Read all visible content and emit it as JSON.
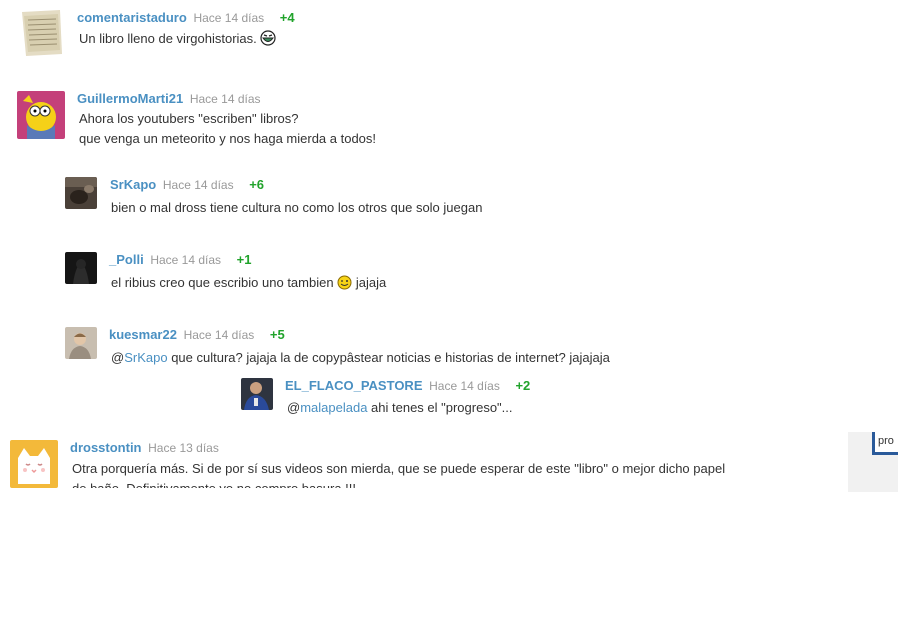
{
  "comments": [
    {
      "user": "comentaristaduro",
      "time": "Hace 14 días",
      "votes": "+4",
      "lines": [
        "Un libro lleno de virgohistorias."
      ]
    },
    {
      "user": "GuillermoMarti21",
      "time": "Hace 14 días",
      "votes": "",
      "lines": [
        "Ahora los youtubers \"escriben\" libros?",
        "que venga un meteorito y nos haga mierda a todos!"
      ]
    },
    {
      "user": "SrKapo",
      "time": "Hace 14 días",
      "votes": "+6",
      "lines": [
        "bien o mal dross tiene cultura no como los otros que solo juegan"
      ]
    },
    {
      "user": "_Polli",
      "time": "Hace 14 días",
      "votes": "+1",
      "text_before": "el ribius creo que escribio uno tambien",
      "text_after": "jajaja"
    },
    {
      "user": "kuesmar22",
      "time": "Hace 14 días",
      "votes": "+5",
      "prefix": "@",
      "mention": "SrKapo",
      "rest": " que cultura? jajaja la de copypâstear noticias e historias de internet? jajajaja"
    },
    {
      "user": "EL_FLACO_PASTORE",
      "time": "Hace 14 días",
      "votes": "+2",
      "prefix": "@",
      "mention": "malapelada",
      "rest": " ahi tenes el \"progreso\"..."
    },
    {
      "user": "drosstontin",
      "time": "Hace 13 días",
      "votes": "",
      "lines": [
        "Otra porquería más. Si de por sí sus videos son mierda, que se puede esperar de este \"libro\" o mejor dicho papel",
        "de baño. Definitivamente yo no compro basura !!!"
      ]
    }
  ],
  "side_box": {
    "text": "pro"
  },
  "icons": [
    "newspaper-avatar",
    "simpsons-avatar",
    "dark-photo-avatar",
    "shadow-avatar",
    "person-photo-avatar",
    "soccer-player-avatar",
    "cat-face-avatar",
    "troll-face-emoji",
    "wink-smiley-emoji"
  ],
  "colors": {
    "username": "#4a90c2",
    "votes": "#21a32b",
    "time": "#999999",
    "text": "#333333"
  }
}
